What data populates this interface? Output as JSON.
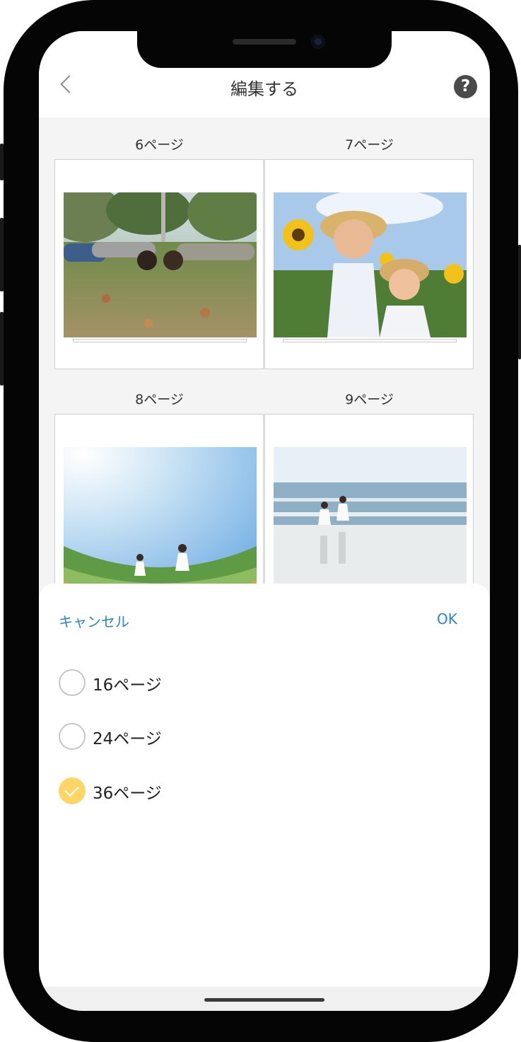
{
  "header": {
    "title": "編集する",
    "back_icon": "chevron-left-icon",
    "help_icon": "question-circle-icon",
    "help_glyph": "?"
  },
  "pages": [
    {
      "label": "6ページ",
      "photo": "children-lying-on-grass"
    },
    {
      "label": "7ページ",
      "photo": "girls-in-sunflower-field"
    },
    {
      "label": "8ページ",
      "photo": "girls-raising-arms-under-sky"
    },
    {
      "label": "9ページ",
      "photo": "girls-walking-on-beach"
    }
  ],
  "sheet": {
    "cancel_label": "キャンセル",
    "ok_label": "OK",
    "options": [
      {
        "label": "16ページ",
        "selected": false
      },
      {
        "label": "24ページ",
        "selected": false
      },
      {
        "label": "36ページ",
        "selected": true
      }
    ]
  },
  "colors": {
    "accent": "#2b86c5",
    "selected_radio": "#ffd566",
    "background": "#f4f4f4"
  }
}
